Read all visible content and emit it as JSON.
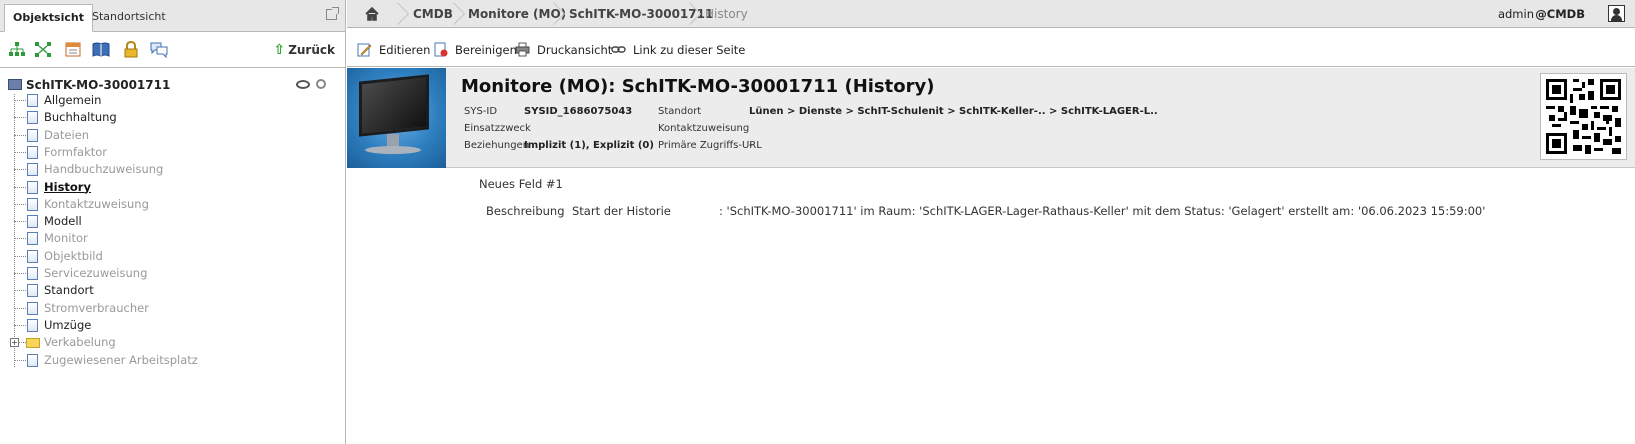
{
  "sidebar": {
    "tabs": [
      "Objektsicht",
      "Standortsicht"
    ],
    "back_label": "Zurück",
    "toolbar_icons": [
      "tree-expand-icon",
      "tree-collapse-icon",
      "calendar-icon",
      "book-icon",
      "lock-icon",
      "comments-icon"
    ],
    "tree": {
      "root": "SchITK-MO-30001711",
      "items": [
        {
          "label": "Allgemein",
          "state": "filled"
        },
        {
          "label": "Buchhaltung",
          "state": "filled"
        },
        {
          "label": "Dateien",
          "state": "empty"
        },
        {
          "label": "Formfaktor",
          "state": "empty"
        },
        {
          "label": "Handbuchzuweisung",
          "state": "empty"
        },
        {
          "label": "History",
          "state": "current"
        },
        {
          "label": "Kontaktzuweisung",
          "state": "empty"
        },
        {
          "label": "Modell",
          "state": "filled"
        },
        {
          "label": "Monitor",
          "state": "empty"
        },
        {
          "label": "Objektbild",
          "state": "empty"
        },
        {
          "label": "Servicezuweisung",
          "state": "empty"
        },
        {
          "label": "Standort",
          "state": "filled"
        },
        {
          "label": "Stromverbraucher",
          "state": "empty"
        },
        {
          "label": "Umzüge",
          "state": "filled"
        },
        {
          "label": "Verkabelung",
          "state": "empty",
          "folder": true
        },
        {
          "label": "Zugewiesener Arbeitsplatz",
          "state": "empty"
        }
      ]
    }
  },
  "topbar": {
    "breadcrumbs": [
      "CMDB",
      "Monitore (MO)",
      "SchITK-MO-30001711",
      "History"
    ],
    "user": "admin",
    "tenant": "@CMDB"
  },
  "actions": {
    "edit": "Editieren",
    "purge": "Bereinigen",
    "print": "Druckansicht",
    "link": "Link zu dieser Seite"
  },
  "object": {
    "title": "Monitore (MO): SchITK-MO-30001711 (History)",
    "sysid_label": "SYS-ID",
    "sysid_value": "SYSID_1686075043",
    "purpose_label": "Einsatzzweck",
    "purpose_value": "",
    "relations_label": "Beziehungen",
    "relations_value": "Implizit (1), Explizit (0)",
    "location_label": "Standort",
    "location_value": "Lünen > Dienste > SchIT-Schulenit > SchITK-Keller-.. > SchITK-LAGER-L..",
    "contact_label": "Kontaktzuweisung",
    "contact_value": "",
    "url_label": "Primäre Zugriffs-URL",
    "url_value": "-"
  },
  "content": {
    "field_title": "Neues Feld #1",
    "desc_label": "Beschreibung",
    "desc_title": "Start der Historie",
    "desc_text": ": 'SchITK-MO-30001711' im Raum: 'SchITK-LAGER-Lager-Rathaus-Keller' mit dem Status: 'Gelagert' erstellt am: '06.06.2023 15:59:00'"
  }
}
